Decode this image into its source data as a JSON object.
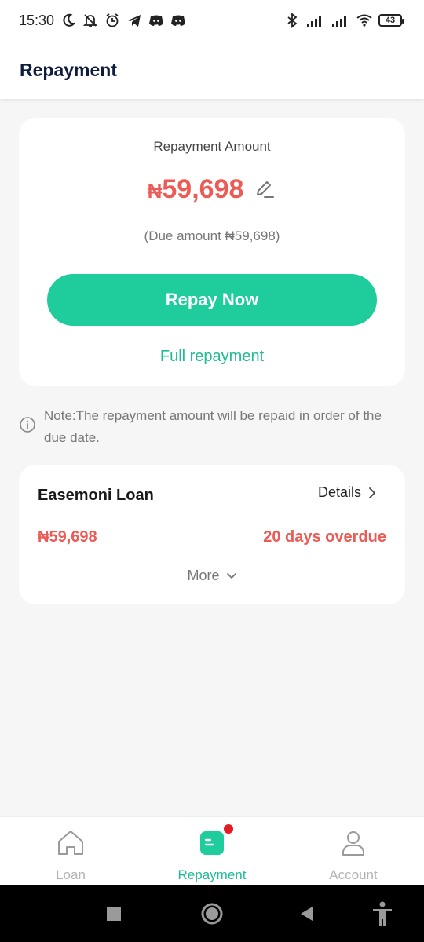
{
  "status_bar": {
    "time": "15:30",
    "battery": "43",
    "icons": [
      "moon-icon",
      "bell-off-icon",
      "alarm-icon",
      "telegram-icon",
      "discord-icon",
      "discord-icon",
      "bluetooth-icon",
      "signal-icon",
      "signal-icon",
      "wifi-icon",
      "battery-icon"
    ]
  },
  "header": {
    "title": "Repayment"
  },
  "repayment_card": {
    "label": "Repayment Amount",
    "currency": "₦",
    "amount": "59,698",
    "due_amount": "(Due amount ₦59,698)",
    "repay_button": "Repay Now",
    "full_repayment": "Full repayment"
  },
  "note": "Note:The repayment amount will be repaid in order of the due date.",
  "loan": {
    "name": "Easemoni Loan",
    "details_label": "Details",
    "amount": "₦59,698",
    "status": "20 days overdue",
    "more_label": "More"
  },
  "bottom_nav": {
    "items": [
      {
        "label": "Loan",
        "icon": "home-icon"
      },
      {
        "label": "Repayment",
        "icon": "repayment-icon",
        "active": true
      },
      {
        "label": "Account",
        "icon": "user-icon"
      }
    ]
  },
  "colors": {
    "accent": "#1fcc9c",
    "accent_text": "#1fbb94",
    "danger": "#ec5b55",
    "title": "#0e1c3e",
    "background": "#f6f6f6"
  }
}
